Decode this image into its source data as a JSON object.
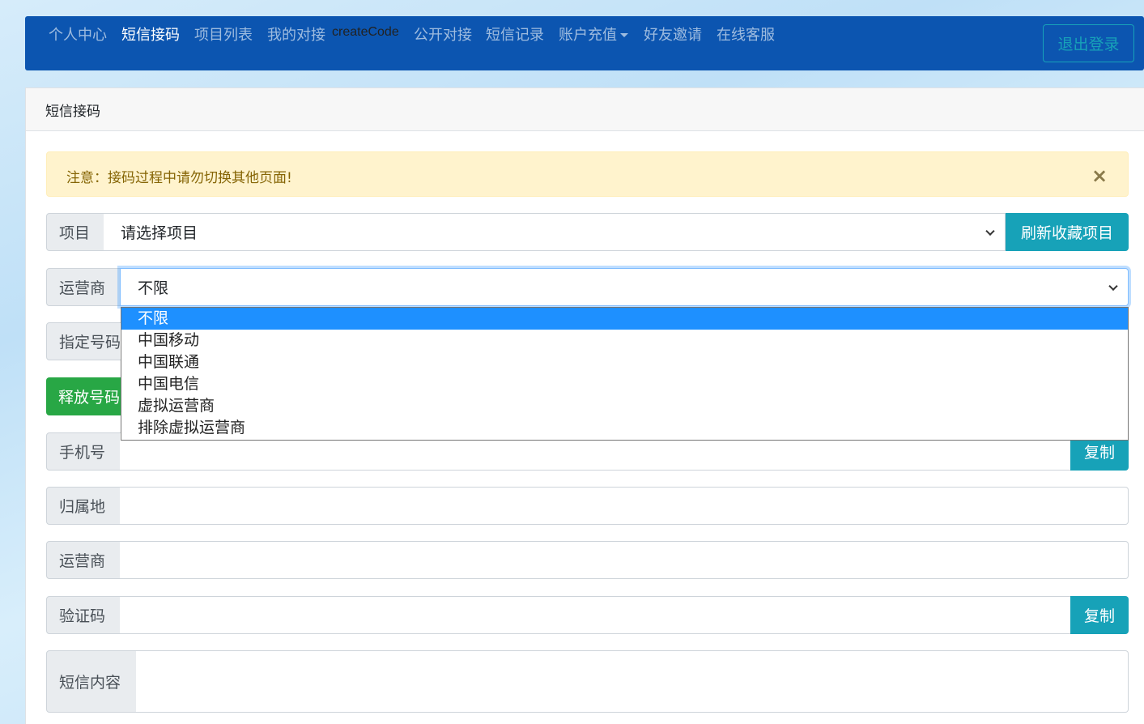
{
  "nav": {
    "items": [
      "个人中心",
      "短信接码",
      "项目列表",
      "我的对接",
      "公开对接",
      "短信记录",
      "账户充值",
      "好友邀请",
      "在线客服"
    ],
    "create_code": "createCode",
    "logout": "退出登录"
  },
  "card": {
    "title": "短信接码"
  },
  "alert": {
    "text": "注意：接码过程中请勿切换其他页面!",
    "close": "×"
  },
  "form": {
    "project_label": "项目",
    "project_value": "请选择项目",
    "refresh_button": "刷新收藏项目",
    "carrier_label": "运营商",
    "carrier_value": "不限",
    "carrier_options": [
      "不限",
      "中国移动",
      "中国联通",
      "中国电信",
      "虚拟运营商",
      "排除虚拟运营商"
    ],
    "number_label": "指定号码",
    "release_button": "释放号码",
    "phone_label": "手机号",
    "copy_button": "复制",
    "location_label": "归属地",
    "carrier2_label": "运营商",
    "code_label": "验证码",
    "sms_label": "短信内容"
  },
  "colors": {
    "nav_bg": "#0c55b0",
    "info": "#17a2b8",
    "success": "#28a745",
    "warning_bg": "#fff3cd"
  }
}
